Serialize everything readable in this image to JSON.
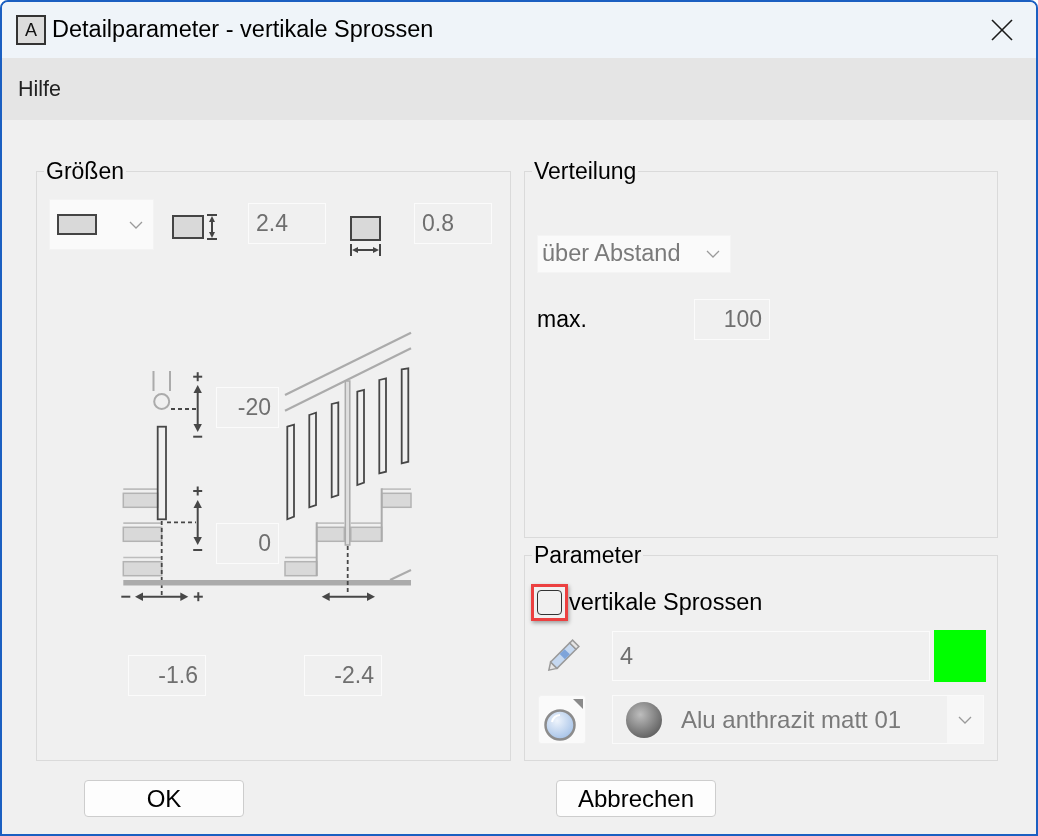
{
  "window": {
    "icon_letter": "A",
    "title": "Detailparameter - vertikale Sprossen"
  },
  "menu": [
    {
      "label": "Hilfe"
    }
  ],
  "sizes": {
    "title": "Größen",
    "height": {
      "value": "2.4",
      "disabled": true
    },
    "width": {
      "value": "0.8",
      "disabled": true
    },
    "top_offset": {
      "value": "-20",
      "disabled": true
    },
    "bottom_offset": {
      "value": "0",
      "disabled": true
    },
    "start_offset": {
      "value": "-1.6",
      "disabled": true
    },
    "post_offset": {
      "value": "-2.4",
      "disabled": true
    }
  },
  "distribution": {
    "title": "Verteilung",
    "mode": {
      "value": "über Abstand",
      "disabled": true
    },
    "max": {
      "label": "max.",
      "value": "100",
      "disabled": true
    }
  },
  "parameter": {
    "title": "Parameter",
    "checkbox": {
      "label": "vertikale Sprossen",
      "checked": false,
      "highlighted": true
    },
    "pen": {
      "value": "4",
      "disabled": true,
      "color": "#00ff00"
    },
    "material": {
      "value": "Alu anthrazit matt 01",
      "disabled": true
    }
  },
  "buttons": [
    {
      "label": "OK"
    },
    {
      "label": "Abbrechen"
    }
  ]
}
